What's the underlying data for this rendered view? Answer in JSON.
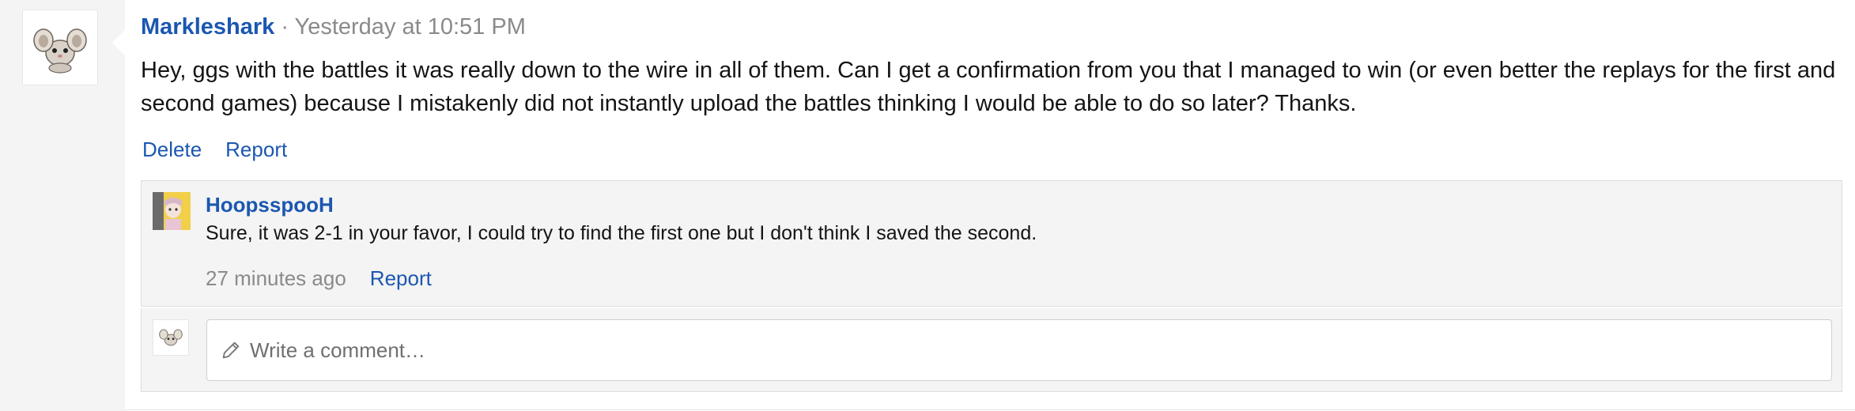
{
  "message": {
    "author": "Markleshark",
    "separator": " · ",
    "timestamp": "Yesterday at 10:51 PM",
    "body": "Hey, ggs with the battles it was really down to the wire in all of them. Can I get a confirmation from you that I managed to win (or even better the replays for the first and second games) because I mistakenly did not instantly upload the battles thinking I would be able to do so later? Thanks.",
    "actions": {
      "delete": "Delete",
      "report": "Report"
    }
  },
  "reply": {
    "author": "HoopsspooH",
    "text": "Sure, it was 2-1 in your favor, I could try to find the first one but I don't think I saved the second.",
    "time_ago": "27 minutes ago",
    "report": "Report"
  },
  "comment": {
    "placeholder": "Write a comment…"
  },
  "colors": {
    "link": "#1b57b1",
    "muted": "#8a8a8a",
    "panel": "#f4f4f4"
  }
}
